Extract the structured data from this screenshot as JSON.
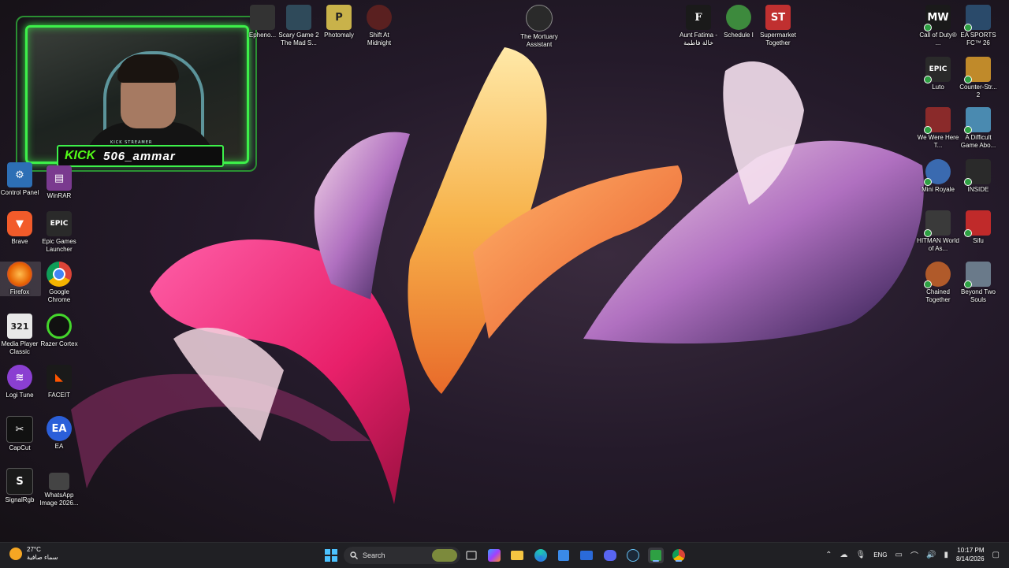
{
  "desktop": {
    "left_col1": [
      {
        "label": "Control Panel",
        "icon": "control-panel-icon",
        "color": "#2d6fb5"
      },
      {
        "label": "Brave",
        "icon": "brave-icon",
        "color": "#f25b2a"
      },
      {
        "label": "Firefox",
        "icon": "firefox-icon",
        "color": "#e66000"
      },
      {
        "label": "Media Player Classic",
        "icon": "media-player-icon",
        "color": "#e8e8e8"
      },
      {
        "label": "Logi Tune",
        "icon": "logi-tune-icon",
        "color": "#8a3fd1"
      },
      {
        "label": "CapCut",
        "icon": "capcut-icon",
        "color": "#111111"
      },
      {
        "label": "SignalRgb",
        "icon": "signalrgb-icon",
        "color": "#1a1a1a"
      }
    ],
    "left_col2": [
      {
        "label": "WinRAR",
        "icon": "winrar-icon",
        "color": "#7a3a8f"
      },
      {
        "label": "Epic Games Launcher",
        "icon": "epic-games-icon",
        "color": "#2a2a2a"
      },
      {
        "label": "Google Chrome",
        "icon": "chrome-icon",
        "color": "#db4437"
      },
      {
        "label": "Razer Cortex",
        "icon": "razer-cortex-icon",
        "color": "#44d62c"
      },
      {
        "label": "FACEIT",
        "icon": "faceit-icon",
        "color": "#ff5500"
      },
      {
        "label": "EA",
        "icon": "ea-icon",
        "color": "#2b5fd9"
      },
      {
        "label": "WhatsApp Image 2026...",
        "icon": "image-file-icon",
        "color": "#444444"
      }
    ],
    "top_row": [
      {
        "label": "Epheno...",
        "icon": "game-icon",
        "color": "#333333"
      },
      {
        "label": "Scary Game 2 The Mad S...",
        "icon": "game-icon",
        "color": "#2f4a5a"
      },
      {
        "label": "Photomaly",
        "icon": "photomaly-icon",
        "color": "#c9b24a"
      },
      {
        "label": "Shift At Midnight",
        "icon": "game-icon",
        "color": "#5a2020"
      },
      {
        "label": "The Mortuary Assistant",
        "icon": "game-icon",
        "color": "#2a2a2a"
      },
      {
        "label": "Aunt Fatima - خالة فاطمة",
        "icon": "game-icon",
        "color": "#1a1a1a"
      },
      {
        "label": "Schedule I",
        "icon": "game-icon",
        "color": "#3d8a3d"
      },
      {
        "label": "Supermarket Together",
        "icon": "game-icon",
        "color": "#c03030"
      }
    ],
    "right_col1": [
      {
        "label": "Call of Duty® ...",
        "icon": "cod-icon",
        "color": "#1a1a1a"
      },
      {
        "label": "Luto",
        "icon": "epic-games-icon",
        "color": "#2a2a2a"
      },
      {
        "label": "We Were Here T...",
        "icon": "game-icon",
        "color": "#8a2a2a"
      },
      {
        "label": "Mini Royale",
        "icon": "game-icon",
        "color": "#3a6ab0"
      },
      {
        "label": "HITMAN World of As...",
        "icon": "game-icon",
        "color": "#3a3a3a"
      },
      {
        "label": "Chained Together",
        "icon": "game-icon",
        "color": "#b05a2a"
      }
    ],
    "right_col2": [
      {
        "label": "EA SPORTS FC™ 26",
        "icon": "game-icon",
        "color": "#2a4a6a"
      },
      {
        "label": "Counter-Str... 2",
        "icon": "game-icon",
        "color": "#c08a2a"
      },
      {
        "label": "A Difficult Game Abo...",
        "icon": "game-icon",
        "color": "#4a8ab0"
      },
      {
        "label": "INSIDE",
        "icon": "game-icon",
        "color": "#2a2a2a"
      },
      {
        "label": "Sifu",
        "icon": "game-icon",
        "color": "#c02a2a"
      },
      {
        "label": "Beyond Two Souls",
        "icon": "game-icon",
        "color": "#6a7a8a"
      }
    ]
  },
  "webcam": {
    "tag": "KICK STREAMER",
    "platform": "KICK",
    "username": "506_ammar"
  },
  "taskbar": {
    "weather_temp": "27°C",
    "weather_desc": "سماء صافية",
    "search_placeholder": "Search",
    "lang": "ENG",
    "time": "10:17 PM",
    "date": "8/14/2026"
  }
}
